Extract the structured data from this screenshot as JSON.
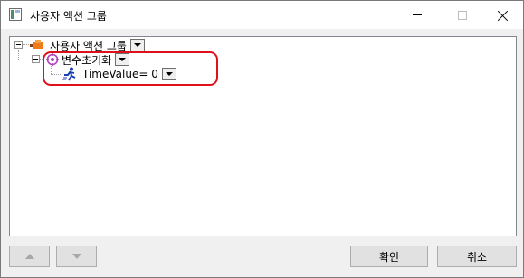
{
  "window": {
    "title": "사용자 액션 그룹"
  },
  "titlebar_buttons": {
    "minimize": "minimize-icon",
    "maximize": "maximize-icon",
    "close": "close-icon"
  },
  "tree": {
    "root": {
      "label": "사용자 액션 그룹",
      "icon": "action-group-icon"
    },
    "child": {
      "label": "변수초기화",
      "icon": "target-icon"
    },
    "leaf": {
      "label": "TimeValue= 0",
      "icon": "running-man-icon"
    }
  },
  "footer": {
    "up_icon": "arrow-up-icon",
    "down_icon": "arrow-down-icon",
    "ok_label": "확인",
    "cancel_label": "취소"
  },
  "colors": {
    "highlight": "#e0101a",
    "root_icon": "#f07a1a",
    "target_icon": "#b040c0",
    "runner_icon": "#1c3fb0"
  }
}
